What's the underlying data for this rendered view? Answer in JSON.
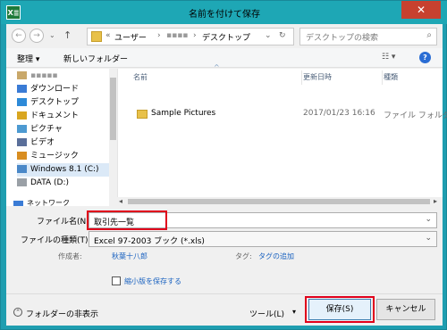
{
  "window": {
    "title": "名前を付けて保存",
    "app_icon": "X≣",
    "close": "✕"
  },
  "nav": {
    "back": "←",
    "forward": "→",
    "up": "↑",
    "crumb_prefix": "«",
    "crumb_user": "ユーザー",
    "crumb_sep": "›",
    "crumb_user_name": "▪▪▪▪",
    "crumb_desktop": "デスクトップ",
    "dropdown": "⌄",
    "refresh": "↻",
    "search_placeholder": "デスクトップの検索"
  },
  "toolbar": {
    "organize": "整理 ▾",
    "new_folder": "新しいフォルダー",
    "view": "☷ ▾",
    "help": "?"
  },
  "sidebar": {
    "top_item": "▪▪▪▪▪",
    "items": [
      {
        "label": "ダウンロード",
        "icon": "download-icon",
        "color": "#3a7bd5"
      },
      {
        "label": "デスクトップ",
        "icon": "desktop-icon",
        "color": "#2d8ad8"
      },
      {
        "label": "ドキュメント",
        "icon": "document-icon",
        "color": "#d9a620"
      },
      {
        "label": "ピクチャ",
        "icon": "picture-icon",
        "color": "#4d9ad1"
      },
      {
        "label": "ビデオ",
        "icon": "video-icon",
        "color": "#5a6f9a"
      },
      {
        "label": "ミュージック",
        "icon": "music-icon",
        "color": "#d98d20"
      },
      {
        "label": "Windows 8.1 (C:)",
        "icon": "drive-icon",
        "color": "#4a88c8"
      },
      {
        "label": "DATA (D:)",
        "icon": "drive-icon",
        "color": "#9aa0a6"
      }
    ],
    "network": "ネットワーク"
  },
  "columns": {
    "name": "名前",
    "modified": "更新日時",
    "type": "種類"
  },
  "files": [
    {
      "name": "Sample Pictures",
      "modified": "2017/01/23 16:16",
      "type": "ファイル フォルダー"
    }
  ],
  "form": {
    "filename_label": "ファイル名(N):",
    "filename_value": "取引先一覧",
    "filetype_label": "ファイルの種類(T):",
    "filetype_value": "Excel 97-2003 ブック (*.xls)",
    "author_label": "作成者:",
    "author_value": "秋葉十八郎",
    "tags_label": "タグ:",
    "tags_value": "タグの追加",
    "thumbnail_label": "縮小版を保存する"
  },
  "footer": {
    "hide_folders": "フォルダーの非表示",
    "tools": "ツール(L)",
    "save": "保存(S)",
    "cancel": "キャンセル"
  },
  "colors": {
    "accent": "#1ea7b5",
    "highlight": "#e0001b",
    "close": "#c7412f",
    "link": "#1a62c0"
  }
}
